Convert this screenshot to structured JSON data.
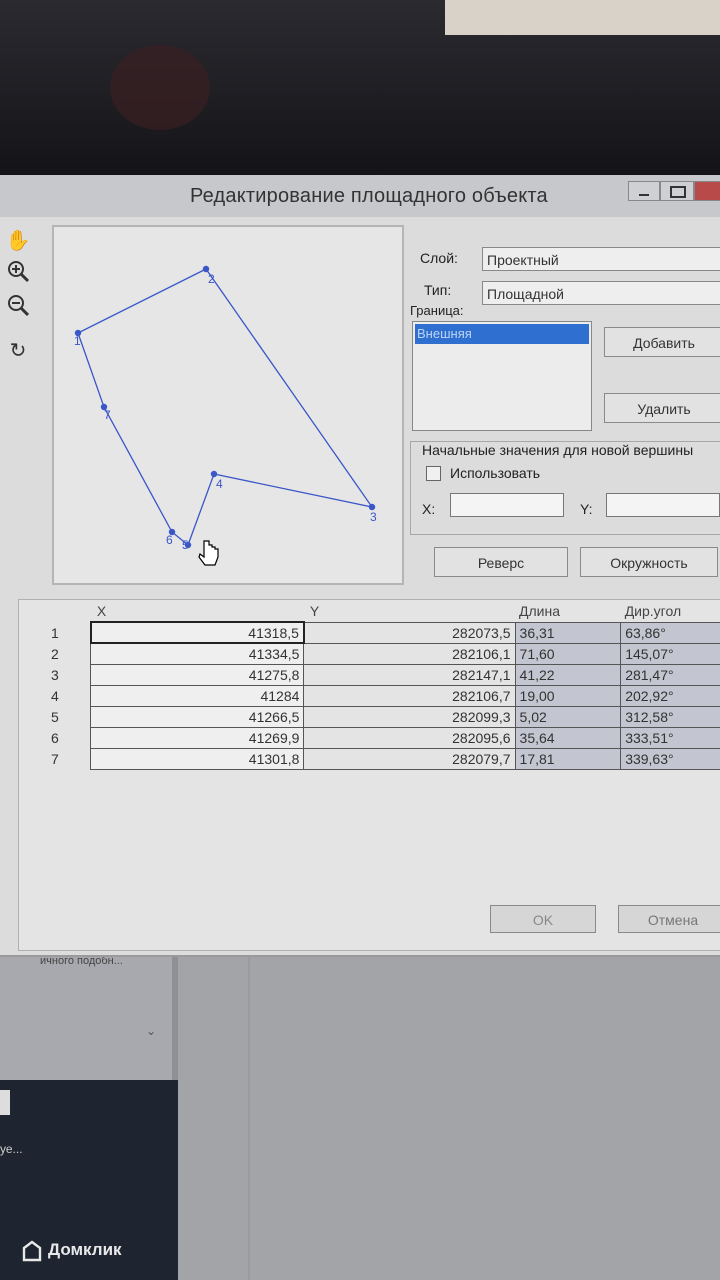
{
  "dialog": {
    "title": "Редактирование площадного объекта"
  },
  "toolbar": {
    "hand_icon": "hand-icon",
    "zoom_in_icon": "zoom-in-icon",
    "zoom_out_icon": "zoom-out-icon",
    "refresh_icon": "refresh-icon"
  },
  "preview": {
    "vertex_labels": [
      "1",
      "2",
      "3",
      "4",
      "5",
      "6",
      "7"
    ],
    "line_color": "#3a56c8"
  },
  "properties": {
    "layer_label": "Слой:",
    "layer_value": "Проектный",
    "type_label": "Тип:",
    "type_value": "Площадной",
    "boundary_label": "Граница:",
    "boundary_items": [
      "Внешняя"
    ],
    "add_button": "Добавить",
    "delete_button": "Удалить",
    "initial_values_label": "Начальные значения для новой вершины",
    "use_checkbox_label": "Использовать",
    "x_label": "X:",
    "y_label": "Y:",
    "x_value": "",
    "y_value": "",
    "reverse_button": "Реверс",
    "circle_button": "Окружность"
  },
  "table": {
    "headers": [
      "",
      "X",
      "Y",
      "Длина",
      "Дир.угол"
    ],
    "rows": [
      {
        "n": "1",
        "x": "41318,5",
        "y": "282073,5",
        "len": "36,31",
        "angle": "63,86°"
      },
      {
        "n": "2",
        "x": "41334,5",
        "y": "282106,1",
        "len": "71,60",
        "angle": "145,07°"
      },
      {
        "n": "3",
        "x": "41275,8",
        "y": "282147,1",
        "len": "41,22",
        "angle": "281,47°"
      },
      {
        "n": "4",
        "x": "41284",
        "y": "282106,7",
        "len": "19,00",
        "angle": "202,92°"
      },
      {
        "n": "5",
        "x": "41266,5",
        "y": "282099,3",
        "len": "5,02",
        "angle": "312,58°"
      },
      {
        "n": "6",
        "x": "41269,9",
        "y": "282095,6",
        "len": "35,64",
        "angle": "333,51°"
      },
      {
        "n": "7",
        "x": "41301,8",
        "y": "282079,7",
        "len": "17,81",
        "angle": "339,63°"
      }
    ]
  },
  "footer": {
    "ok_button": "OK",
    "cancel_button": "Отмена"
  },
  "background": {
    "watermark": "Домклик",
    "partial_text": "ичного подобн...",
    "partial_text_2": "уе..."
  }
}
